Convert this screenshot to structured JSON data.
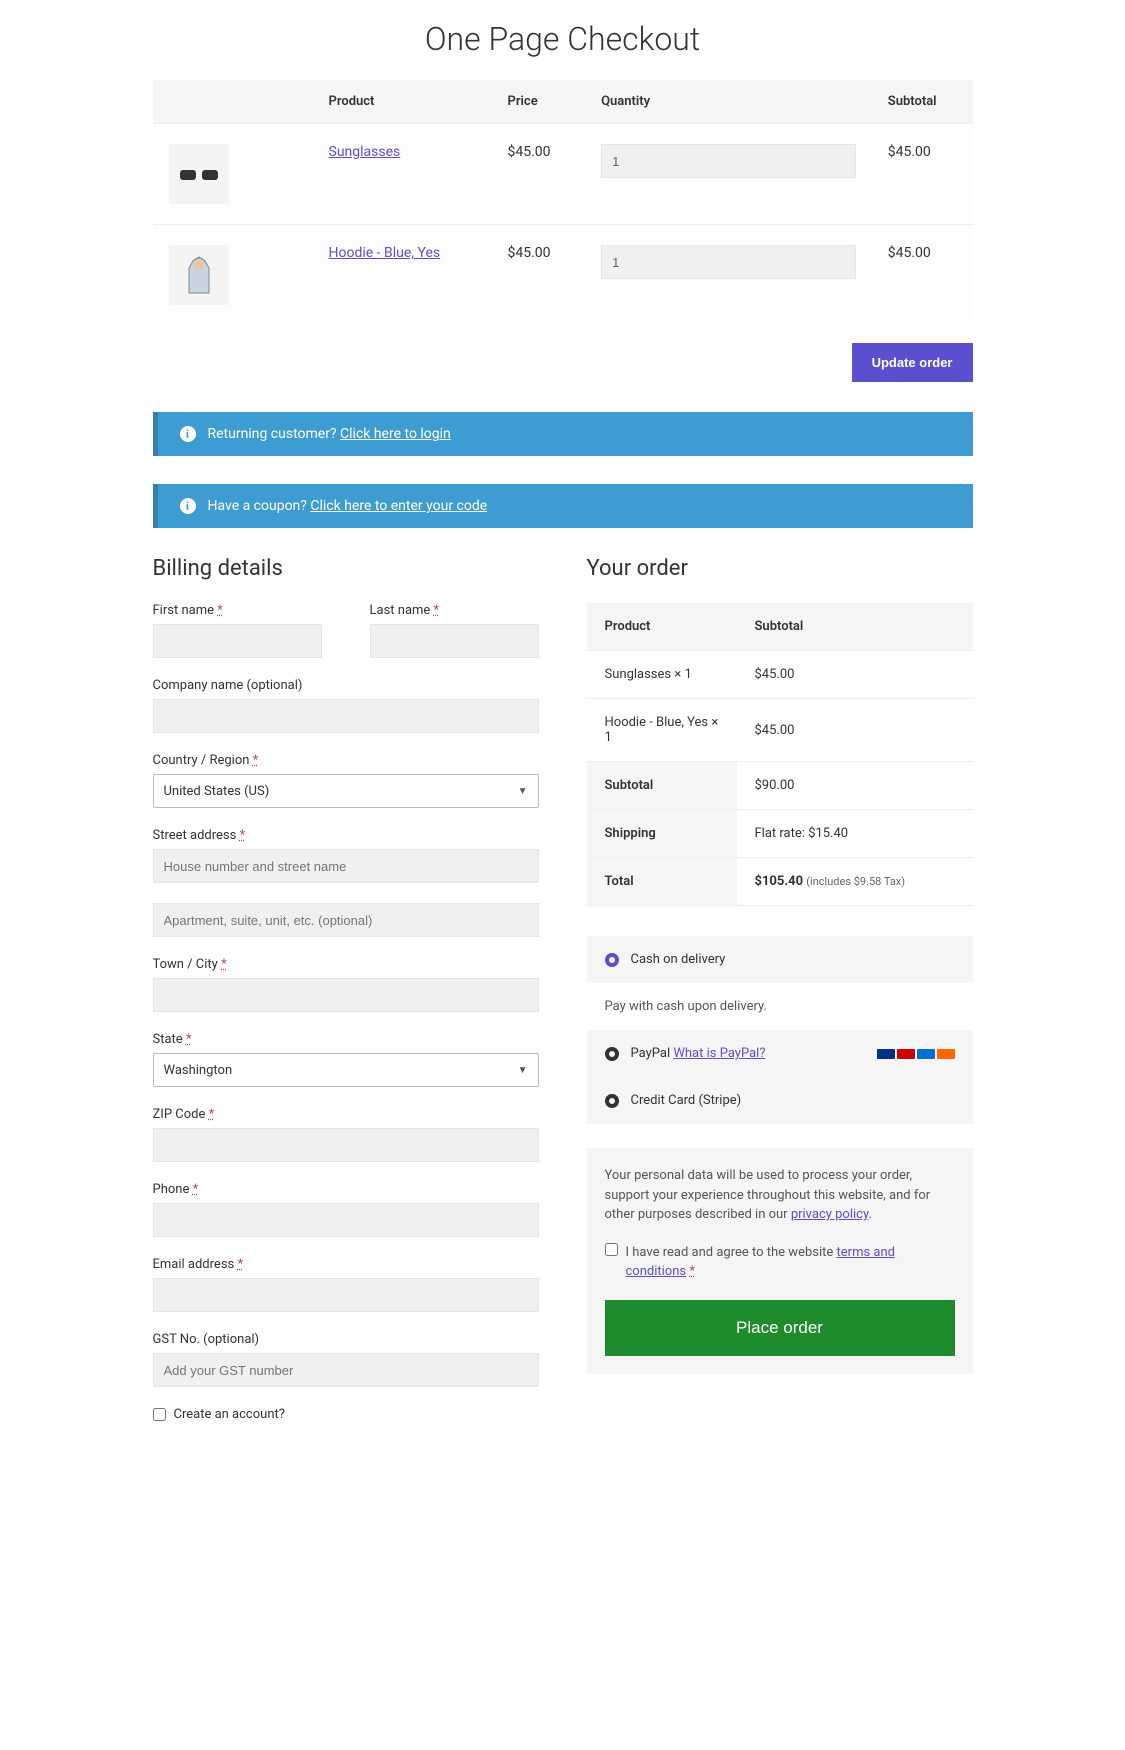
{
  "title": "One Page Checkout",
  "cart": {
    "headers": {
      "product": "Product",
      "price": "Price",
      "quantity": "Quantity",
      "subtotal": "Subtotal"
    },
    "items": [
      {
        "name": "Sunglasses",
        "price": "$45.00",
        "qty": "1",
        "subtotal": "$45.00"
      },
      {
        "name": "Hoodie - Blue, Yes",
        "price": "$45.00",
        "qty": "1",
        "subtotal": "$45.00"
      }
    ],
    "update_btn": "Update order"
  },
  "banners": {
    "login_prefix": "Returning customer? ",
    "login_link": "Click here to login",
    "coupon_prefix": "Have a coupon? ",
    "coupon_link": "Click here to enter your code"
  },
  "billing": {
    "heading": "Billing details",
    "first_name": "First name",
    "last_name": "Last name",
    "company": "Company name (optional)",
    "country": "Country / Region",
    "country_value": "United States (US)",
    "street": "Street address",
    "street_ph1": "House number and street name",
    "street_ph2": "Apartment, suite, unit, etc. (optional)",
    "city": "Town / City",
    "state": "State",
    "state_value": "Washington",
    "zip": "ZIP Code",
    "phone": "Phone",
    "email": "Email address",
    "gst": "GST No. (optional)",
    "gst_ph": "Add your GST number",
    "create_account": "Create an account?",
    "req": "*"
  },
  "order": {
    "heading": "Your order",
    "product_h": "Product",
    "subtotal_h": "Subtotal",
    "lines": [
      {
        "name": "Sunglasses  × 1",
        "amount": "$45.00"
      },
      {
        "name": "Hoodie - Blue, Yes  × 1",
        "amount": "$45.00"
      }
    ],
    "subtotal_label": "Subtotal",
    "subtotal_val": "$90.00",
    "shipping_label": "Shipping",
    "shipping_val": "Flat rate: $15.40",
    "total_label": "Total",
    "total_val": "$105.40",
    "tax_note": "(includes $9.58 Tax)"
  },
  "payment": {
    "cod": "Cash on delivery",
    "cod_desc": "Pay with cash upon delivery.",
    "paypal": "PayPal",
    "paypal_link": "What is PayPal?",
    "stripe": "Credit Card (Stripe)"
  },
  "privacy": {
    "text": "Your personal data will be used to process your order, support your experience throughout this website, and for other purposes described in our ",
    "link": "privacy policy",
    "terms_prefix": "I have read and agree to the website ",
    "terms_link": "terms and conditions",
    "place_order": "Place order"
  }
}
